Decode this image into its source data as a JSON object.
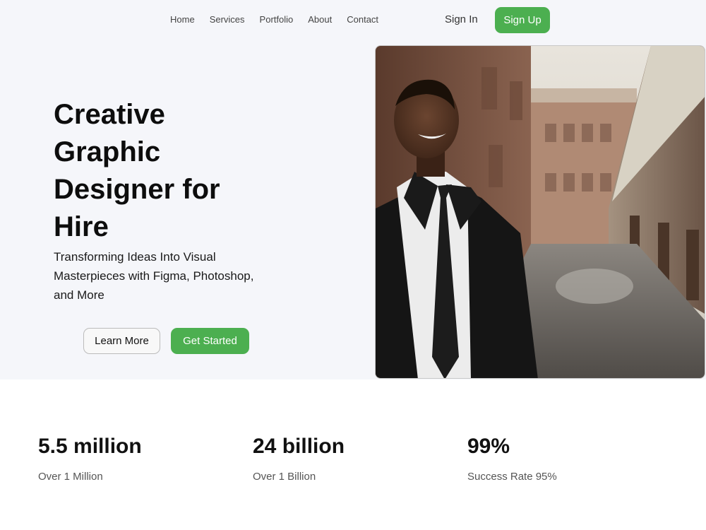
{
  "nav": {
    "links": [
      "Home",
      "Services",
      "Portfolio",
      "About",
      "Contact"
    ],
    "sign_in": "Sign In",
    "sign_up": "Sign Up"
  },
  "hero": {
    "title": "Creative Graphic Designer for Hire",
    "subtitle": "Transforming Ideas Into Visual Masterpieces with Figma, Photoshop, and More",
    "learn_more": "Learn More",
    "get_started": "Get Started"
  },
  "stats": [
    {
      "value": "5.5 million",
      "label": "Over 1 Million"
    },
    {
      "value": "24 billion",
      "label": "Over 1 Billion"
    },
    {
      "value": "99%",
      "label": "Success Rate 95%"
    }
  ],
  "colors": {
    "accent": "#4caf50",
    "hero_background": "#f5f6fa"
  }
}
